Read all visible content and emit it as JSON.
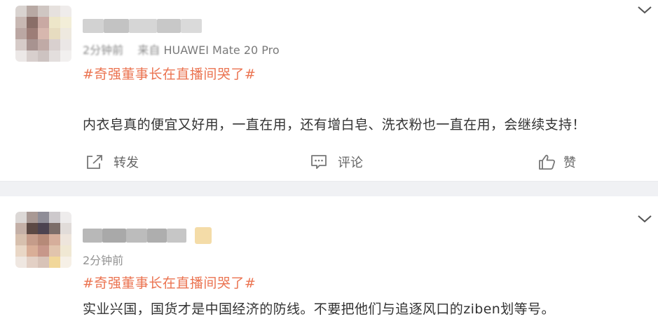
{
  "posts": [
    {
      "meta": {
        "time": "2分钟前",
        "source_prefix": "来自",
        "device": "HUAWEI Mate 20 Pro"
      },
      "hashtag": "#奇强董事长在直播间哭了#",
      "content": "内衣皂真的便宜又好用，一直在用，还有增白皂、洗衣粉也一直在用，会继续支持！",
      "actions": {
        "repost": "转发",
        "comment": "评论",
        "like": "赞"
      }
    },
    {
      "meta": {
        "time": "2分钟前"
      },
      "hashtag": "#奇强董事长在直播间哭了#",
      "content": "实业兴国，国货才是中国经济的防线。不要把他们与追逐风口的ziben划等号。"
    }
  ],
  "colors": {
    "hashtag": "#eb7350",
    "text": "#333333",
    "meta": "#939393",
    "separator": "#f0f1f4"
  },
  "icons": {
    "repost": "share-square-icon",
    "comment": "comment-bubble-icon",
    "like": "thumbs-up-icon",
    "more": "chevron-down-icon"
  }
}
